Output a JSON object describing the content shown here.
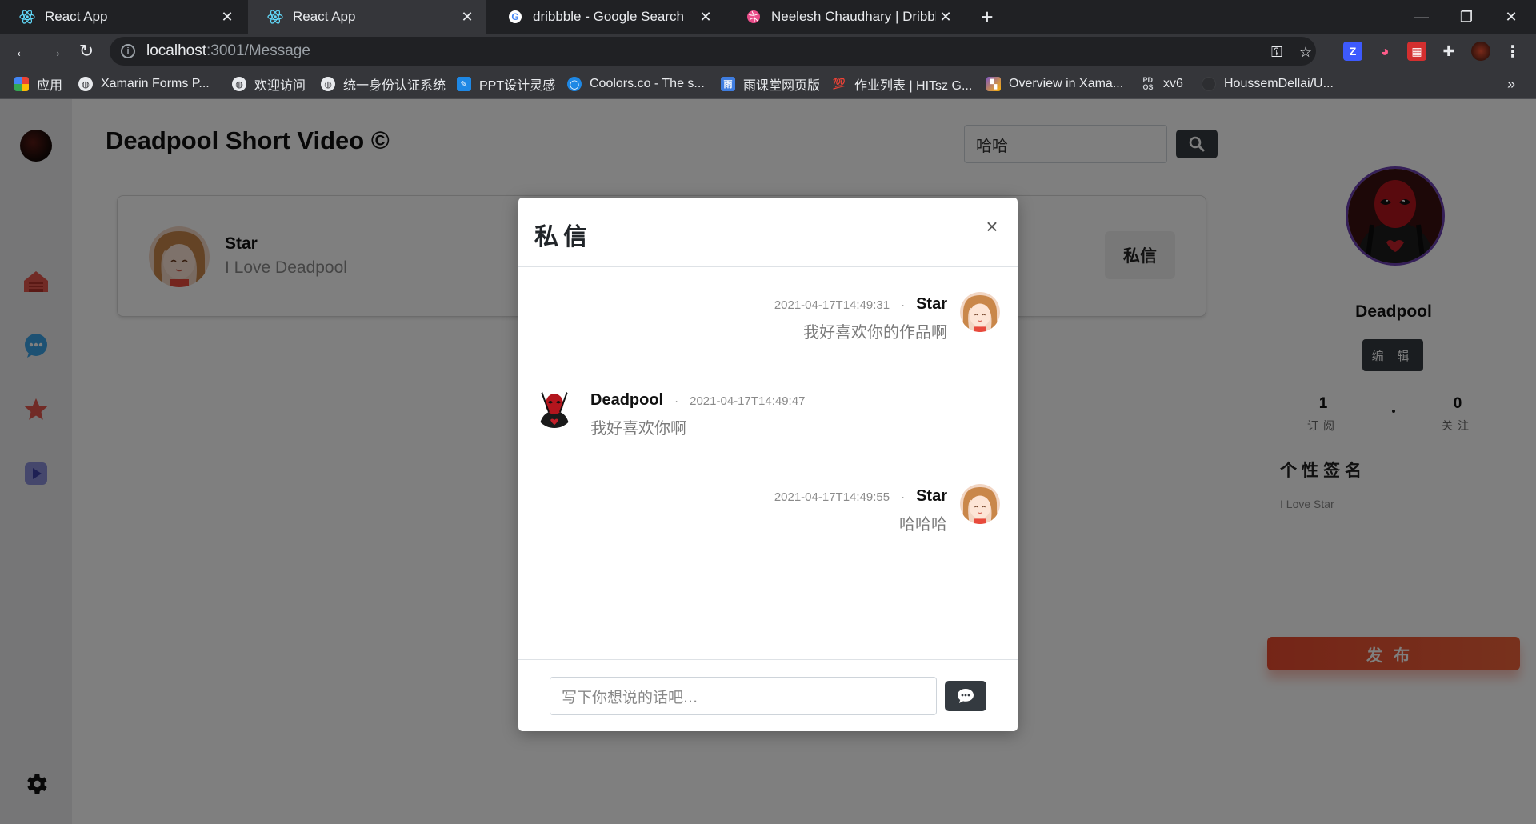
{
  "browser": {
    "tabs": [
      {
        "title": "React App",
        "active": false,
        "favicon": "react-icon"
      },
      {
        "title": "React App",
        "active": true,
        "favicon": "react-icon"
      },
      {
        "title": "dribbble - Google Search",
        "active": false,
        "favicon": "google-icon"
      },
      {
        "title": "Neelesh Chaudhary | Dribbble",
        "active": false,
        "favicon": "dribbble-icon"
      }
    ],
    "url_host": "localhost",
    "url_path": ":3001/Message",
    "bookmarks": [
      {
        "label": "应用",
        "icon": "apps-grid-icon"
      },
      {
        "label": "Xamarin Forms P...",
        "icon": "globe-icon"
      },
      {
        "label": "欢迎访问",
        "icon": "globe-icon"
      },
      {
        "label": "统一身份认证系统",
        "icon": "globe-icon"
      },
      {
        "label": "PPT设计灵感",
        "icon": "feather-icon"
      },
      {
        "label": "Coolors.co - The s...",
        "icon": "coolors-icon"
      },
      {
        "label": "雨课堂网页版",
        "icon": "rain-class-icon"
      },
      {
        "label": "作业列表 | HITsz G...",
        "icon": "hundred-icon"
      },
      {
        "label": "Overview in Xama...",
        "icon": "xamarin-icon"
      },
      {
        "label": "xv6",
        "icon": "pdos-icon"
      },
      {
        "label": "HoussemDellai/U...",
        "icon": "github-icon"
      }
    ],
    "more_bookmarks": "»"
  },
  "app": {
    "title": "Deadpool Short Video ©",
    "search_value": "哈哈",
    "card": {
      "name": "Star",
      "signature": "I Love Deadpool",
      "message_button": "私信"
    },
    "profile": {
      "name": "Deadpool",
      "edit_button": "编 辑",
      "subscribe_count": "1",
      "subscribe_label": "订阅",
      "follow_count": "0",
      "follow_label": "关注",
      "signature_title": "个性签名",
      "signature": "I Love Star",
      "publish_button": "发布"
    }
  },
  "modal": {
    "title": "私信",
    "close": "×",
    "messages": [
      {
        "side": "right",
        "name": "Star",
        "time": "2021-04-17T14:49:31",
        "text": "我好喜欢你的作品啊"
      },
      {
        "side": "left",
        "name": "Deadpool",
        "time": "2021-04-17T14:49:47",
        "text": "我好喜欢你啊"
      },
      {
        "side": "right",
        "name": "Star",
        "time": "2021-04-17T14:49:55",
        "text": "哈哈哈"
      }
    ],
    "input_placeholder": "写下你想说的话吧..."
  },
  "colors": {
    "accent_dark": "#343a40",
    "publish": "#ea4b2f",
    "avatar_ring": "#6b3fb1"
  }
}
